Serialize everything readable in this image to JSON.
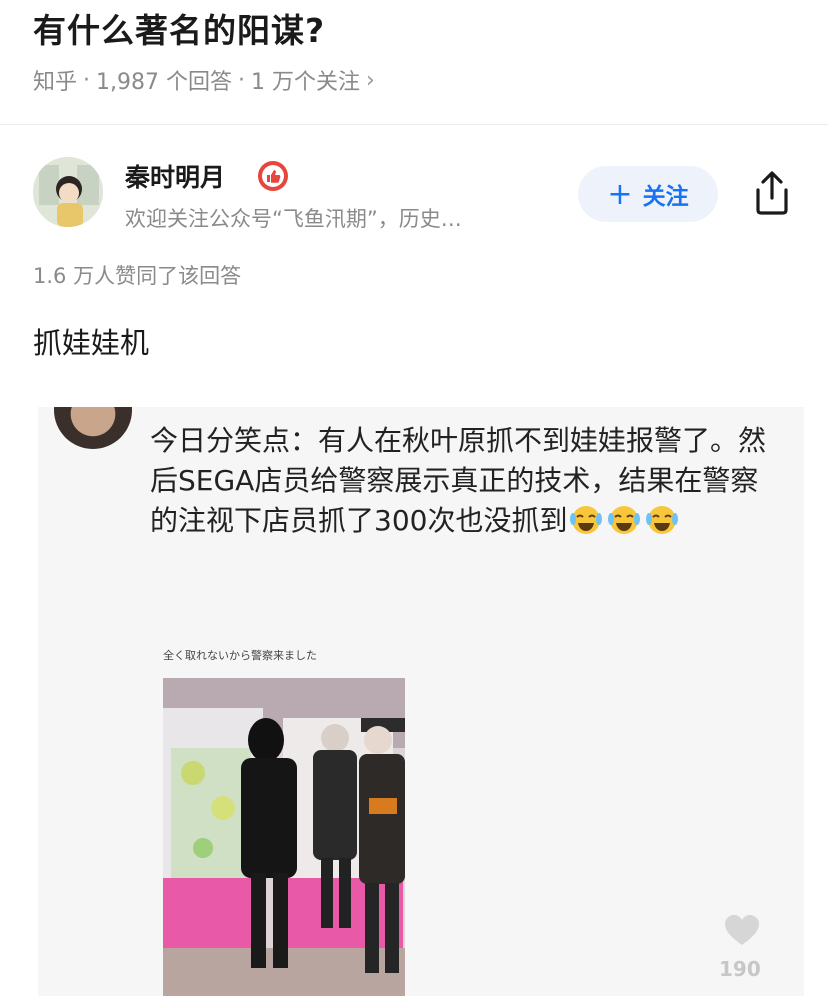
{
  "question": {
    "title": "有什么著名的阳谋?",
    "source": "知乎",
    "answers": "1,987 个回答",
    "followers": "1 万个关注"
  },
  "author": {
    "name": "秦时明月",
    "bio": "欢迎关注公众号“飞鱼汛期”，历史…",
    "follow_label": "关注"
  },
  "answer": {
    "votes": "1.6 万人赞同了该回答",
    "text": "抓娃娃机"
  },
  "embedded_post": {
    "text": "今日分笑点：有人在秋叶原抓不到娃娃报警了。然后SEGA店员给警察展示真正的技术，结果在警察的注视下店员抓了300次也没抓到",
    "caption": "全く取れないから警察来ました",
    "like_count": "190"
  },
  "colors": {
    "accent": "#1772f6",
    "follow_bg": "#eef3fb",
    "badge": "#e8453c",
    "muted": "#8a8a8a"
  },
  "icons": {
    "chevron": "chevron-right-icon",
    "badge": "thumb-up-badge-icon",
    "share": "share-icon",
    "like": "heart-icon",
    "emoji": "laughing-crying-emoji-icon"
  }
}
